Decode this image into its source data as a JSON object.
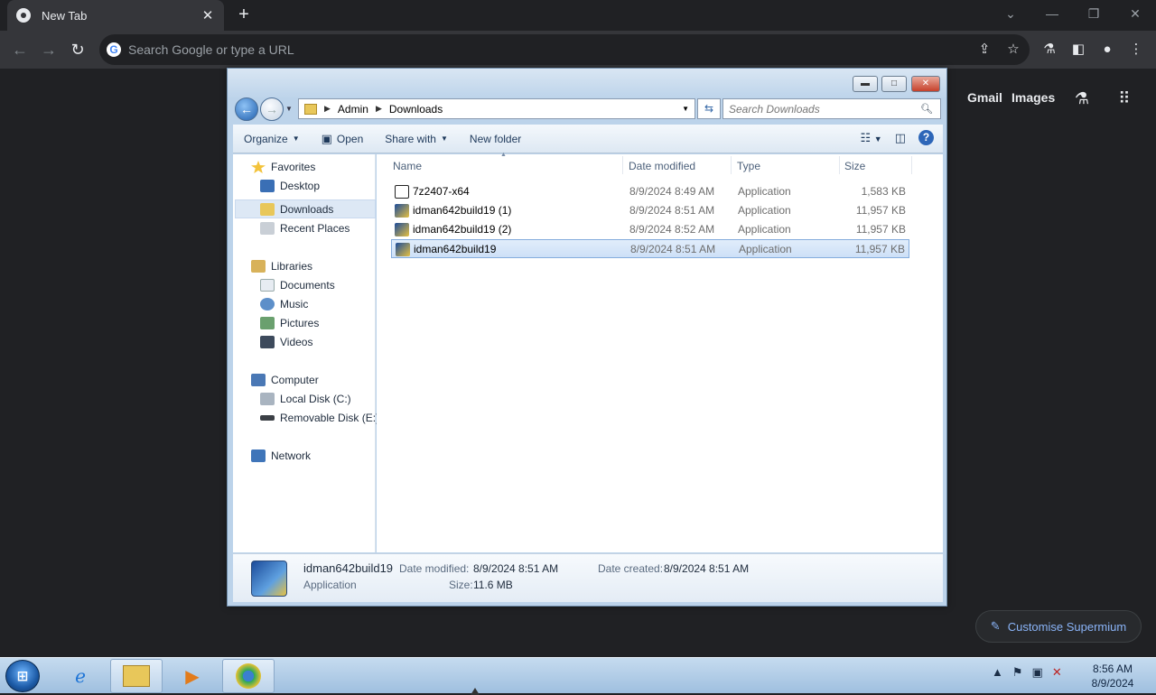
{
  "browser": {
    "tab_title": "New Tab",
    "tab_close": "✕",
    "new_tab": "+",
    "omnibox_placeholder": "Search Google or type a URL",
    "links": {
      "gmail": "Gmail",
      "images": "Images"
    },
    "customise_label": "Customise Supermium",
    "icons": [
      "back-icon",
      "forward-icon",
      "reload-icon",
      "share-icon",
      "star-icon",
      "labs-icon",
      "sidepanel-icon",
      "profile-icon",
      "menu-icon",
      "apps-icon"
    ]
  },
  "explorer": {
    "breadcrumb": [
      "Admin",
      "Downloads"
    ],
    "search_placeholder": "Search Downloads",
    "toolbar": {
      "organize": "Organize",
      "open": "Open",
      "share_with": "Share with",
      "new_folder": "New folder",
      "help": "?"
    },
    "nav": {
      "favorites": "Favorites",
      "desktop": "Desktop",
      "downloads": "Downloads",
      "recent_places": "Recent Places",
      "libraries": "Libraries",
      "documents": "Documents",
      "music": "Music",
      "pictures": "Pictures",
      "videos": "Videos",
      "computer": "Computer",
      "local_disk": "Local Disk (C:)",
      "removable_disk": "Removable Disk (E:)",
      "network": "Network"
    },
    "columns": {
      "name": "Name",
      "date_modified": "Date modified",
      "type": "Type",
      "size": "Size"
    },
    "files": [
      {
        "name": "7z2407-x64",
        "date": "8/9/2024 8:49 AM",
        "type": "Application",
        "size": "1,583 KB"
      },
      {
        "name": "idman642build19 (1)",
        "date": "8/9/2024 8:51 AM",
        "type": "Application",
        "size": "11,957 KB"
      },
      {
        "name": "idman642build19 (2)",
        "date": "8/9/2024 8:52 AM",
        "type": "Application",
        "size": "11,957 KB"
      },
      {
        "name": "idman642build19",
        "date": "8/9/2024 8:51 AM",
        "type": "Application",
        "size": "11,957 KB"
      }
    ],
    "selected_index": 3,
    "details": {
      "name": "idman642build19",
      "kind": "Application",
      "date_modified_label": "Date modified:",
      "date_modified": "8/9/2024 8:51 AM",
      "date_created_label": "Date created:",
      "date_created": "8/9/2024 8:51 AM",
      "size_label": "Size:",
      "size": "11.6 MB"
    }
  },
  "taskbar": {
    "clock_time": "8:56 AM",
    "clock_date": "8/9/2024",
    "apps": [
      "internet-explorer-icon",
      "file-explorer-icon",
      "media-player-icon",
      "chrome-icon"
    ]
  }
}
